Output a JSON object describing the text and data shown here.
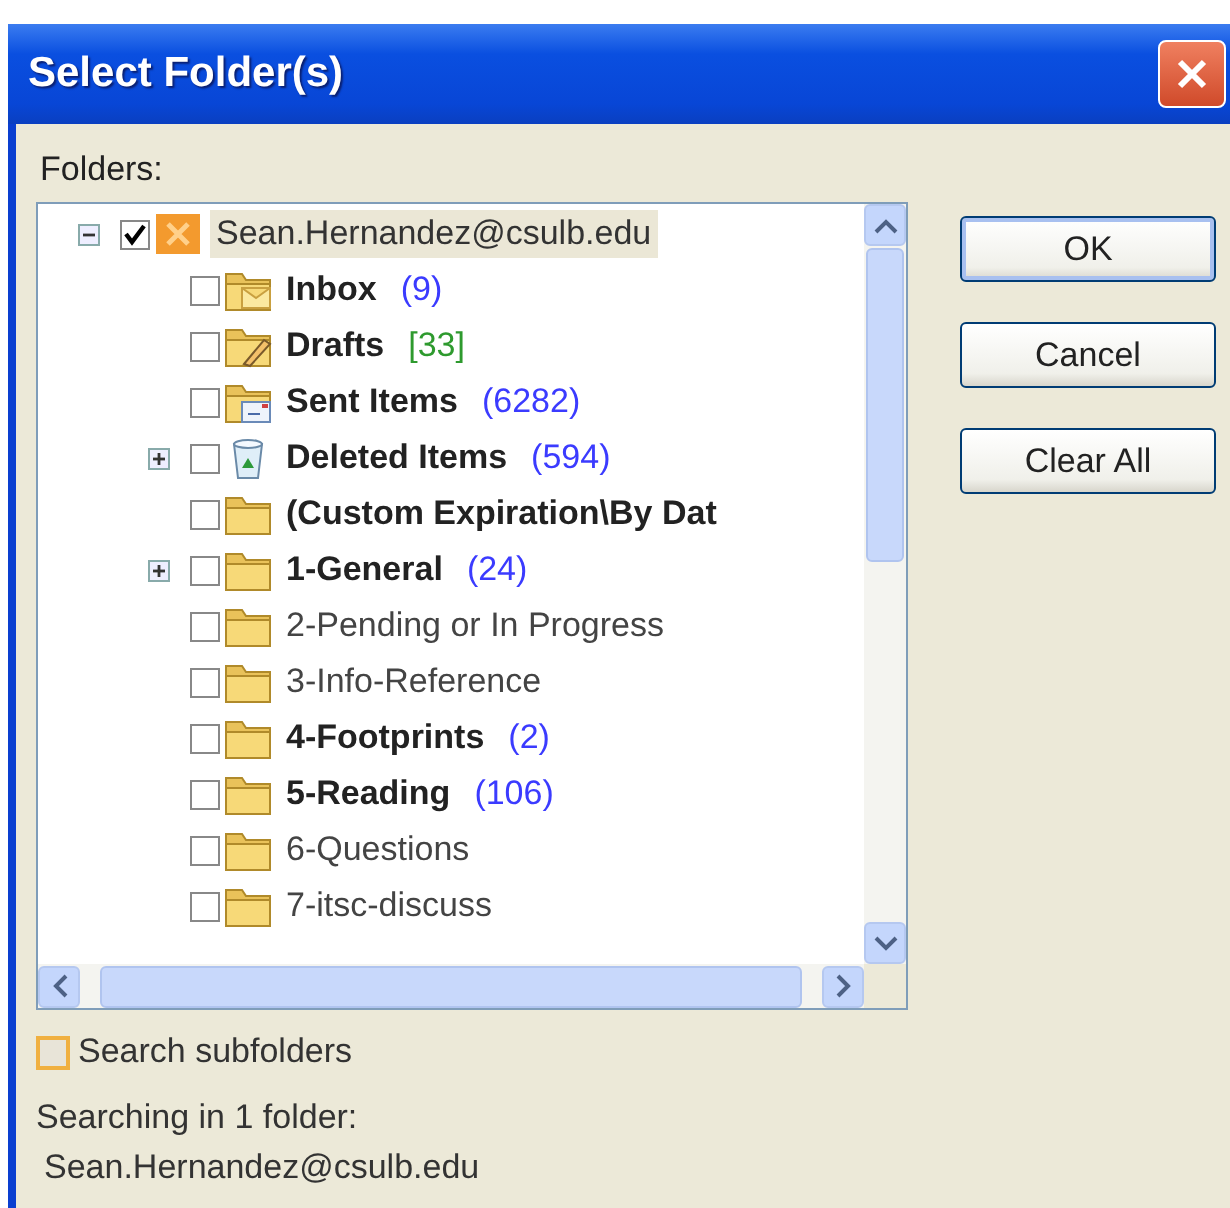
{
  "window": {
    "title": "Select Folder(s)"
  },
  "folders_label": "Folders:",
  "tree": [
    {
      "name": "Sean.Hernandez@csulb.edu",
      "kind": "account",
      "bold": false,
      "checked": true,
      "selected": true,
      "expandable": true,
      "expanded": true,
      "children": [
        {
          "name": "Inbox",
          "kind": "inbox",
          "bold": true,
          "checked": false,
          "selected": false,
          "expandable": false,
          "count": "(9)",
          "color": "#3b3bff"
        },
        {
          "name": "Drafts",
          "kind": "drafts",
          "bold": true,
          "checked": false,
          "selected": false,
          "expandable": false,
          "count": "[33]",
          "color": "#2e9a2e"
        },
        {
          "name": "Sent Items",
          "kind": "sent",
          "bold": true,
          "checked": false,
          "selected": false,
          "expandable": false,
          "count": "(6282)",
          "color": "#3b3bff"
        },
        {
          "name": "Deleted Items",
          "kind": "deleted",
          "bold": true,
          "checked": false,
          "selected": false,
          "expandable": true,
          "expanded": false,
          "count": "(594)",
          "color": "#3b3bff"
        },
        {
          "name": "(Custom Expiration\\By Dat",
          "kind": "folder",
          "bold": true,
          "checked": false,
          "selected": false,
          "expandable": false
        },
        {
          "name": "1-General",
          "kind": "folder",
          "bold": true,
          "checked": false,
          "selected": false,
          "expandable": true,
          "expanded": false,
          "count": "(24)",
          "color": "#3b3bff"
        },
        {
          "name": "2-Pending or In Progress",
          "kind": "folder",
          "bold": false,
          "checked": false,
          "selected": false,
          "expandable": false
        },
        {
          "name": "3-Info-Reference",
          "kind": "folder",
          "bold": false,
          "checked": false,
          "selected": false,
          "expandable": false
        },
        {
          "name": "4-Footprints",
          "kind": "folder",
          "bold": true,
          "checked": false,
          "selected": false,
          "expandable": false,
          "count": "(2)",
          "color": "#3b3bff"
        },
        {
          "name": "5-Reading",
          "kind": "folder",
          "bold": true,
          "checked": false,
          "selected": false,
          "expandable": false,
          "count": "(106)",
          "color": "#3b3bff"
        },
        {
          "name": "6-Questions",
          "kind": "folder",
          "bold": false,
          "checked": false,
          "selected": false,
          "expandable": false
        },
        {
          "name": "7-itsc-discuss",
          "kind": "folder",
          "bold": false,
          "checked": false,
          "selected": false,
          "expandable": false
        }
      ]
    }
  ],
  "buttons": [
    {
      "label": "OK",
      "default": true
    },
    {
      "label": "Cancel",
      "default": false
    },
    {
      "label": "Clear All",
      "default": false
    }
  ],
  "search_subfolders": {
    "label": "Search subfolders",
    "checked": false
  },
  "status": [
    "Searching in 1 folder:",
    "Sean.Hernandez@csulb.edu"
  ]
}
